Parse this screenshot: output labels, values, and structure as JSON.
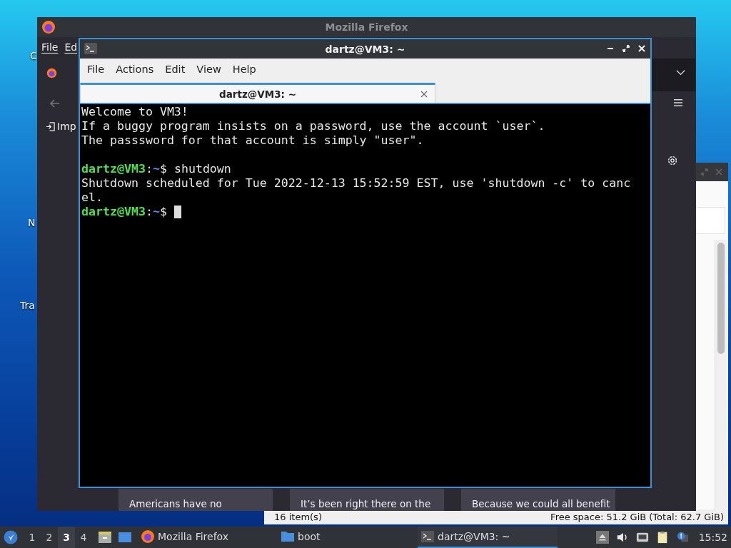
{
  "desktop": {
    "icons": [
      {
        "label": "C"
      },
      {
        "label": "N"
      },
      {
        "label": "Tra"
      }
    ]
  },
  "file_manager": {
    "status_items": "16 item(s)",
    "free_space": "Free space: 51.2 GiB (Total: 62.7 GiB)"
  },
  "firefox": {
    "title": "Mozilla Firefox",
    "menu": [
      "File",
      "Ed"
    ],
    "toolbar_button": "Imp",
    "cards": [
      {
        "text": "Americans have no"
      },
      {
        "text": "It’s been right there on the"
      },
      {
        "text": "Because we could all benefit"
      }
    ]
  },
  "terminal": {
    "title": "dartz@VM3: ~",
    "menu": [
      "File",
      "Actions",
      "Edit",
      "View",
      "Help"
    ],
    "tabs": [
      {
        "label": "dartz@VM3: ~",
        "selected": true
      }
    ],
    "lines": [
      {
        "kind": "output",
        "text": "Welcome to VM3!"
      },
      {
        "kind": "output",
        "text": "If a buggy program insists on a password, use the account `user`."
      },
      {
        "kind": "output",
        "text": "The passsword for that account is simply \"user\"."
      },
      {
        "kind": "blank"
      },
      {
        "kind": "prompt",
        "user": "dartz@VM3",
        "separator": ":",
        "path": "~",
        "sign": "$",
        "command": "shutdown"
      },
      {
        "kind": "output",
        "text": "Shutdown scheduled for Tue 2022-12-13 15:52:59 EST, use 'shutdown -c' to canc"
      },
      {
        "kind": "output",
        "text": "el."
      },
      {
        "kind": "prompt",
        "user": "dartz@VM3",
        "separator": ":",
        "path": "~",
        "sign": "$",
        "cursor": true
      }
    ]
  },
  "taskbar": {
    "workspaces": [
      {
        "label": "1",
        "selected": false
      },
      {
        "label": "2",
        "selected": false
      },
      {
        "label": "3",
        "selected": true
      },
      {
        "label": "4",
        "selected": false
      }
    ],
    "tasks": [
      {
        "kind": "firefox",
        "label": "Mozilla Firefox",
        "selected": false
      },
      {
        "kind": "folder",
        "label": "boot",
        "selected": false
      },
      {
        "kind": "terminal",
        "label": "dartz@VM3: ~",
        "selected": true
      }
    ],
    "clock": "15:52"
  }
}
